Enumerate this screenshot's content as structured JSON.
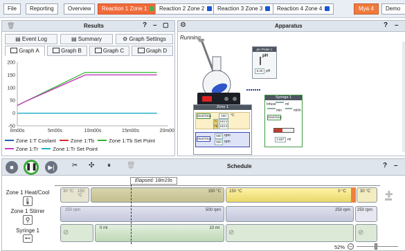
{
  "tabs": [
    {
      "label": "File"
    },
    {
      "label": "Reporting"
    },
    {
      "label": "Overview"
    },
    {
      "label": "Reaction 1 Zone 1",
      "color": "#4caf50"
    },
    {
      "label": "Reaction 2 Zone 2",
      "color": "#1a56d6"
    },
    {
      "label": "Reaction 3 Zone 3",
      "color": "#1a56d6"
    },
    {
      "label": "Reaction 4 Zone 4",
      "color": "#1a56d6"
    }
  ],
  "user_button": "Mya 4",
  "demo_button": "Demo",
  "results": {
    "title": "Results",
    "event_log": "Event Log",
    "summary": "Summary",
    "graph_settings": "Graph Settings",
    "graph_tabs": [
      "Graph A",
      "Graph B",
      "Graph C",
      "Graph D"
    ]
  },
  "chart_data": {
    "type": "line",
    "ylim": [
      -50,
      200
    ],
    "yticks": [
      "200",
      "150",
      "100",
      "50",
      "0",
      "-50"
    ],
    "xticks": [
      "0m00s",
      "5m00s",
      "10m00s",
      "15m00s",
      "20m00s"
    ],
    "x": [
      0,
      1,
      9,
      18.5
    ],
    "series": [
      {
        "name": "Zone 1:T Coolant",
        "color": "#1f5fb8",
        "values": [
          0,
          0,
          0,
          0
        ]
      },
      {
        "name": "Zone 1:Tb",
        "color": "#d62a2a",
        "values": [
          30,
          45,
          150,
          150
        ]
      },
      {
        "name": "Zone 1:Tb Set Point",
        "color": "#2fb52f",
        "values": [
          30,
          45,
          160,
          160
        ]
      },
      {
        "name": "Zone 1:Tr",
        "color": "#c43ac8",
        "values": [
          30,
          45,
          150,
          150
        ]
      },
      {
        "name": "Zone 1:Tr Set Point",
        "color": "#1ab3c6",
        "values": [
          0,
          0,
          0,
          0
        ]
      }
    ]
  },
  "apparatus": {
    "title": "Apparatus",
    "status": "Running",
    "ph_probe": {
      "title": "pH Probe 1",
      "unit": "pH",
      "value": "8.40",
      "value_unit": "pH"
    },
    "zone": {
      "title": "Zone 1",
      "start_stop": "Start/Stop",
      "setpoint": "150",
      "setpoint_unit": "°C",
      "tr_label": "Tr",
      "tr_value": "163.2",
      "tb_label": "Tb",
      "tb_value": "163.6",
      "stir_start": "Start/Stop",
      "stir_set": "500",
      "stir_unit": "rpm",
      "stir_actual": "500",
      "stir_actual_unit": "rpm"
    },
    "syringe": {
      "title": "Syringe 1",
      "infuse": "Infuse",
      "vol_unit": "ml",
      "rate_unit1": "min",
      "rate_unit2": "ml/m",
      "start_stop": "Start/Stop",
      "value": "2.607",
      "value_unit": "ml"
    }
  },
  "schedule": {
    "title": "Schedule",
    "elapsed": "Elapsed: 18m19s",
    "rows": [
      {
        "label": "Zone 1 Heat/Cool"
      },
      {
        "label": "Zone 1 Stirrer"
      },
      {
        "label": "Syringe 1"
      }
    ],
    "heat": {
      "start": "30 °C",
      "seg1a": "150 °C",
      "seg1b": "150 °C",
      "seg2a": "150 °C",
      "seg2b": "0 °C",
      "seg3": "30 °C"
    },
    "stir": {
      "a": "250 rpm",
      "b": "500 rpm",
      "c": "250 rpm",
      "d": "250 rpm"
    },
    "syr": {
      "a": "0 ml",
      "b": "10 ml"
    },
    "zoom": "52%"
  }
}
